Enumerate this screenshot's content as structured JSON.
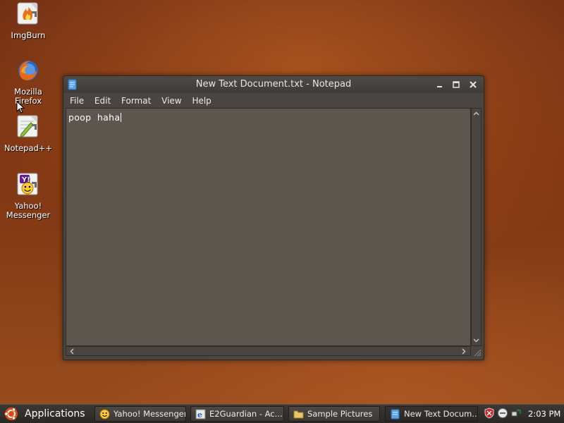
{
  "desktop": {
    "icons": [
      {
        "label": "ImgBurn",
        "icon": "imgburn-icon"
      },
      {
        "label_line1": "Mozilla",
        "label_line2": "Firefox",
        "icon": "firefox-icon"
      },
      {
        "label": "Notepad++",
        "icon": "notepad-plus-plus-icon"
      },
      {
        "label_line1": "Yahoo!",
        "label_line2": "Messenger",
        "icon": "yahoo-messenger-icon"
      }
    ]
  },
  "window": {
    "title": "New Text Document.txt - Notepad",
    "menu": [
      "File",
      "Edit",
      "Format",
      "View",
      "Help"
    ],
    "content": "poop  haha"
  },
  "taskbar": {
    "start_label": "Applications",
    "tasks": [
      {
        "label": "Yahoo! Messenger",
        "icon": "yahoo-smiley-icon"
      },
      {
        "label": "E2Guardian - Ac...",
        "icon": "ie-icon"
      },
      {
        "label": "Sample Pictures",
        "icon": "folder-icon"
      },
      {
        "label": "New Text Docum...",
        "icon": "notepad-icon"
      }
    ],
    "clock": "2:03 PM"
  },
  "colors": {
    "desktop_bg": "#7e3512",
    "window_bg": "#4a4541",
    "editor_bg": "#5d564f",
    "taskbar_bg": "#2a2725"
  }
}
